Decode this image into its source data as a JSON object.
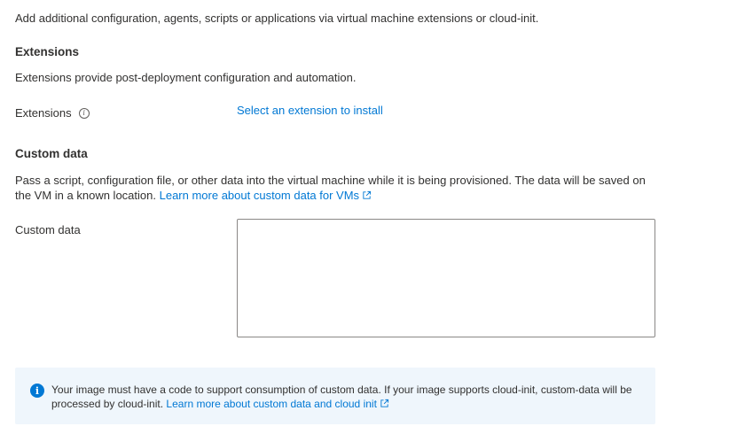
{
  "intro": "Add additional configuration, agents, scripts or applications via virtual machine extensions or cloud-init.",
  "extensions": {
    "title": "Extensions",
    "description": "Extensions provide post-deployment configuration and automation.",
    "label": "Extensions",
    "info_icon": "info-icon",
    "select_link": "Select an extension to install"
  },
  "custom_data": {
    "title": "Custom data",
    "description": "Pass a script, configuration file, or other data into the virtual machine while it is being provisioned. The data will be saved on the VM in a known location.",
    "learn_more_link": "Learn more about custom data for VMs",
    "external_icon": "external-link-icon",
    "label": "Custom data",
    "value": ""
  },
  "info_box": {
    "icon": "info-filled-icon",
    "text": "Your image must have a code to support consumption of custom data. If your image supports cloud-init, custom-data will be processed by cloud-init.",
    "link": "Learn more about custom data and cloud init",
    "external_icon": "external-link-icon"
  },
  "colors": {
    "link": "#0078d4",
    "text": "#323130",
    "info_bg": "#eff6fc",
    "info_icon": "#0078d4",
    "border": "#8a8886"
  }
}
